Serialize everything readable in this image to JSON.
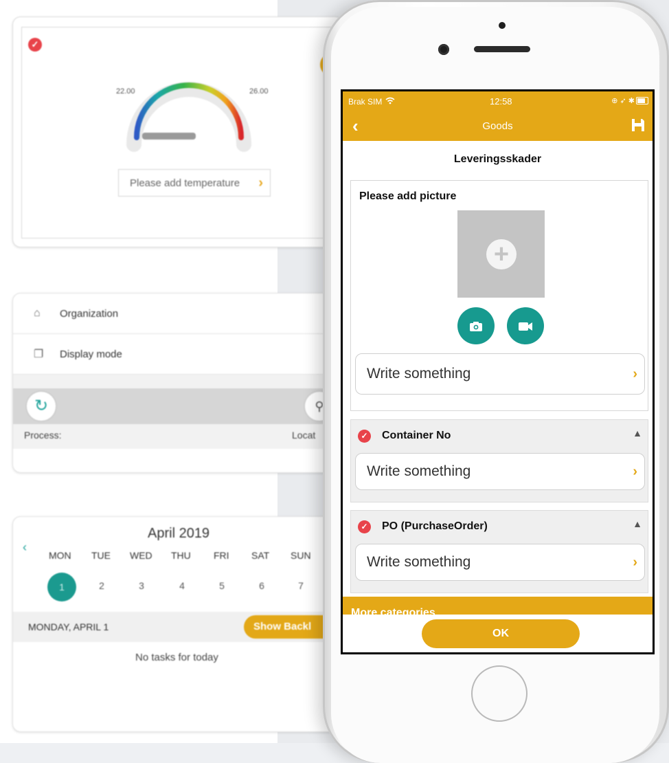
{
  "colors": {
    "accent": "#e4a817",
    "teal": "#179a8f",
    "alert_red": "#e8434a"
  },
  "temperature_card": {
    "min_label": "22.00",
    "max_label": "26.00",
    "add_button": "Please add temperature",
    "chevron": "›"
  },
  "settings_card": {
    "organization_label": "Organization",
    "display_mode_label": "Display mode",
    "process_label": "Process:",
    "location_label": "Locat"
  },
  "calendar_card": {
    "month_title": "April 2019",
    "weekdays": [
      "MON",
      "TUE",
      "WED",
      "THU",
      "FRI",
      "SAT",
      "SUN"
    ],
    "days": [
      "1",
      "2",
      "3",
      "4",
      "5",
      "6",
      "7"
    ],
    "selected_date": "MONDAY, APRIL 1",
    "backlog_button": "Show Backl",
    "empty_text": "No tasks for today"
  },
  "phone": {
    "status": {
      "carrier": "Brak SIM",
      "time": "12:58"
    },
    "nav": {
      "title": "Goods",
      "back_icon": "chevron-left-icon",
      "save_icon": "floppy-disk-icon"
    },
    "content_title": "Leveringsskader",
    "picture_section": {
      "title": "Please add picture",
      "field_text": "Write something"
    },
    "sections": [
      {
        "title": "Container No",
        "field_text": "Write something"
      },
      {
        "title": "PO (PurchaseOrder)",
        "field_text": "Write something"
      }
    ],
    "more_label": "More categories",
    "ok_button": "OK"
  }
}
